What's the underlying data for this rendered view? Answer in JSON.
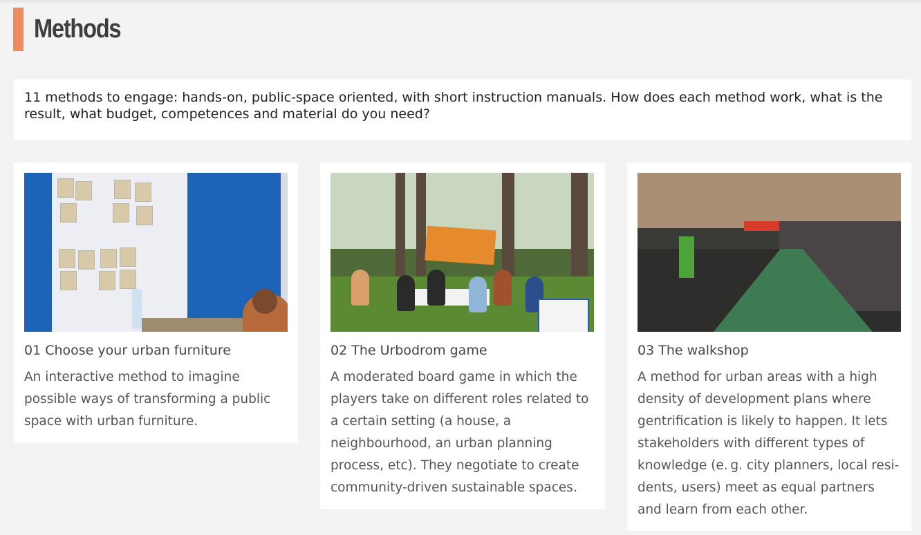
{
  "page": {
    "heading": "Methods",
    "intro": "11 methods to engage: hands-on, public-space oriented, with short instruction manuals. How does each method work, what is the result, what budget, competences and material do you need?"
  },
  "colors": {
    "accent": "#ef8a5f",
    "background": "#f3f3f3",
    "card": "#ffffff"
  },
  "cards": [
    {
      "title": "01 Choose your urban furniture",
      "description": "An interactive method to imagine possible ways of transforming a public space with urban furniture."
    },
    {
      "title": "02 The Urbodrom game",
      "description": "A moderated board game in which the players take on different roles related to a certain setting (a house, a neighbourhood, an urban planning process, etc). They negotiate to create community-driven sustainable spaces."
    },
    {
      "title": "03 The walkshop",
      "description": "A method for urban areas with a high density of development plans where gentrification is likely to happen. It lets stakeholders with different types of knowledge (e. g. city planners, local resi-dents, users) meet as equal partners and learn from each other."
    }
  ]
}
